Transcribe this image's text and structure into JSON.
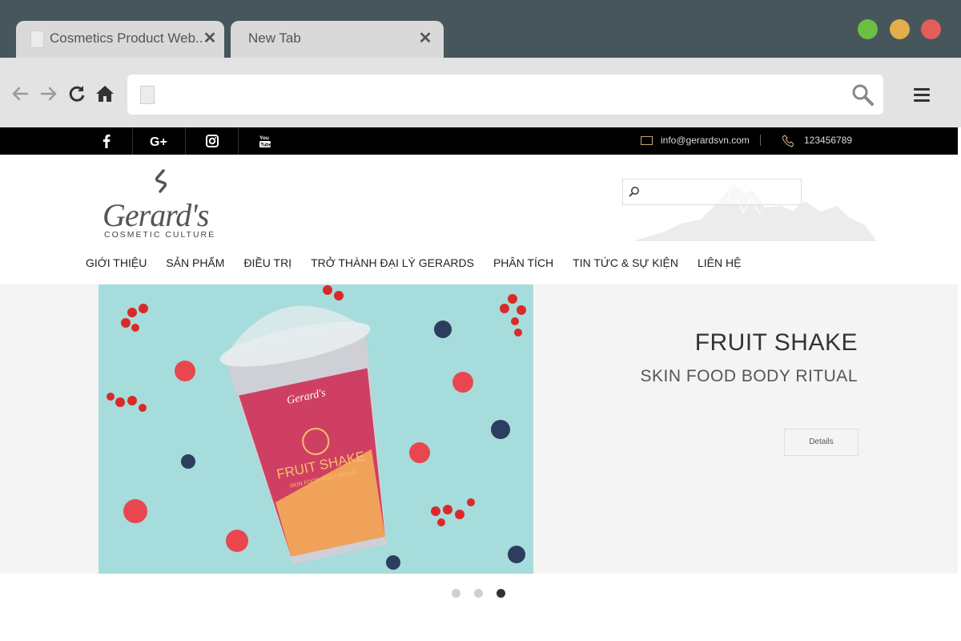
{
  "browser": {
    "tabs": [
      {
        "title": "Cosmetics Product Web..",
        "close": "✕"
      },
      {
        "title": "New Tab",
        "close": "✕"
      }
    ],
    "address": "",
    "icons": [
      "back-arrow-icon",
      "forward-arrow-icon",
      "reload-icon",
      "home-icon",
      "search-icon",
      "hamburger-menu-icon"
    ],
    "traffic_colors": {
      "green": "#6dbe45",
      "yellow": "#e3ad4a",
      "red": "#e35d5b"
    }
  },
  "topbar": {
    "social": [
      "f",
      "G+",
      "instagram",
      "YouTube"
    ],
    "email": "info@gerardsvn.com",
    "phone": "123456789"
  },
  "logo": {
    "word": "Gerard's",
    "tagline": "COSMETIC CULTURE"
  },
  "search": {
    "placeholder": ""
  },
  "nav": [
    "GIỚI THIỆU",
    "SẢN PHẨM",
    "ĐIỀU TRỊ",
    "TRỞ THÀNH ĐẠI LÝ GERARDS",
    "PHÂN TÍCH",
    "TIN TỨC & SỰ KIỆN",
    "LIÊN HỆ"
  ],
  "hero": {
    "title": "FRUIT SHAKE",
    "subtitle": "SKIN FOOD BODY RITUAL",
    "button": "Details",
    "cup_brand": "Gerard's",
    "cup_title": "FRUIT SHAKE",
    "cup_sub": "SKIN FOOD BODY RITUAL",
    "background": "#a6dcdb"
  },
  "carousel": {
    "count": 3,
    "active": 3
  }
}
